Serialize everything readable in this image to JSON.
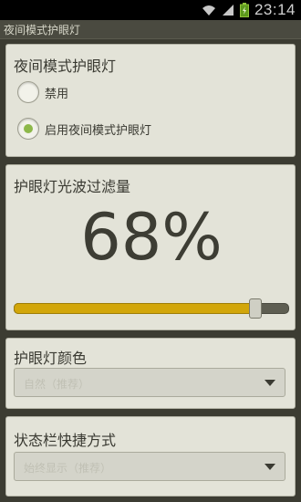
{
  "statusbar": {
    "time": "23:14",
    "icons": [
      "wifi-icon",
      "signal-icon",
      "battery-icon"
    ]
  },
  "app": {
    "title": "夜间模式护眼灯"
  },
  "night_mode": {
    "heading": "夜间模式护眼灯",
    "options": [
      {
        "label": "禁用",
        "selected": false
      },
      {
        "label": "启用夜间模式护眼灯",
        "selected": true
      }
    ]
  },
  "filter": {
    "heading": "护眼灯光波过滤量",
    "value_text": "68%",
    "value": 68
  },
  "color": {
    "heading": "护眼灯颜色",
    "selected": "自然（推荐）"
  },
  "shortcut": {
    "heading": "状态栏快捷方式",
    "selected": "始终显示（推荐）"
  },
  "colors": {
    "accent": "#d2a60a",
    "radio_on": "#8db84a"
  }
}
